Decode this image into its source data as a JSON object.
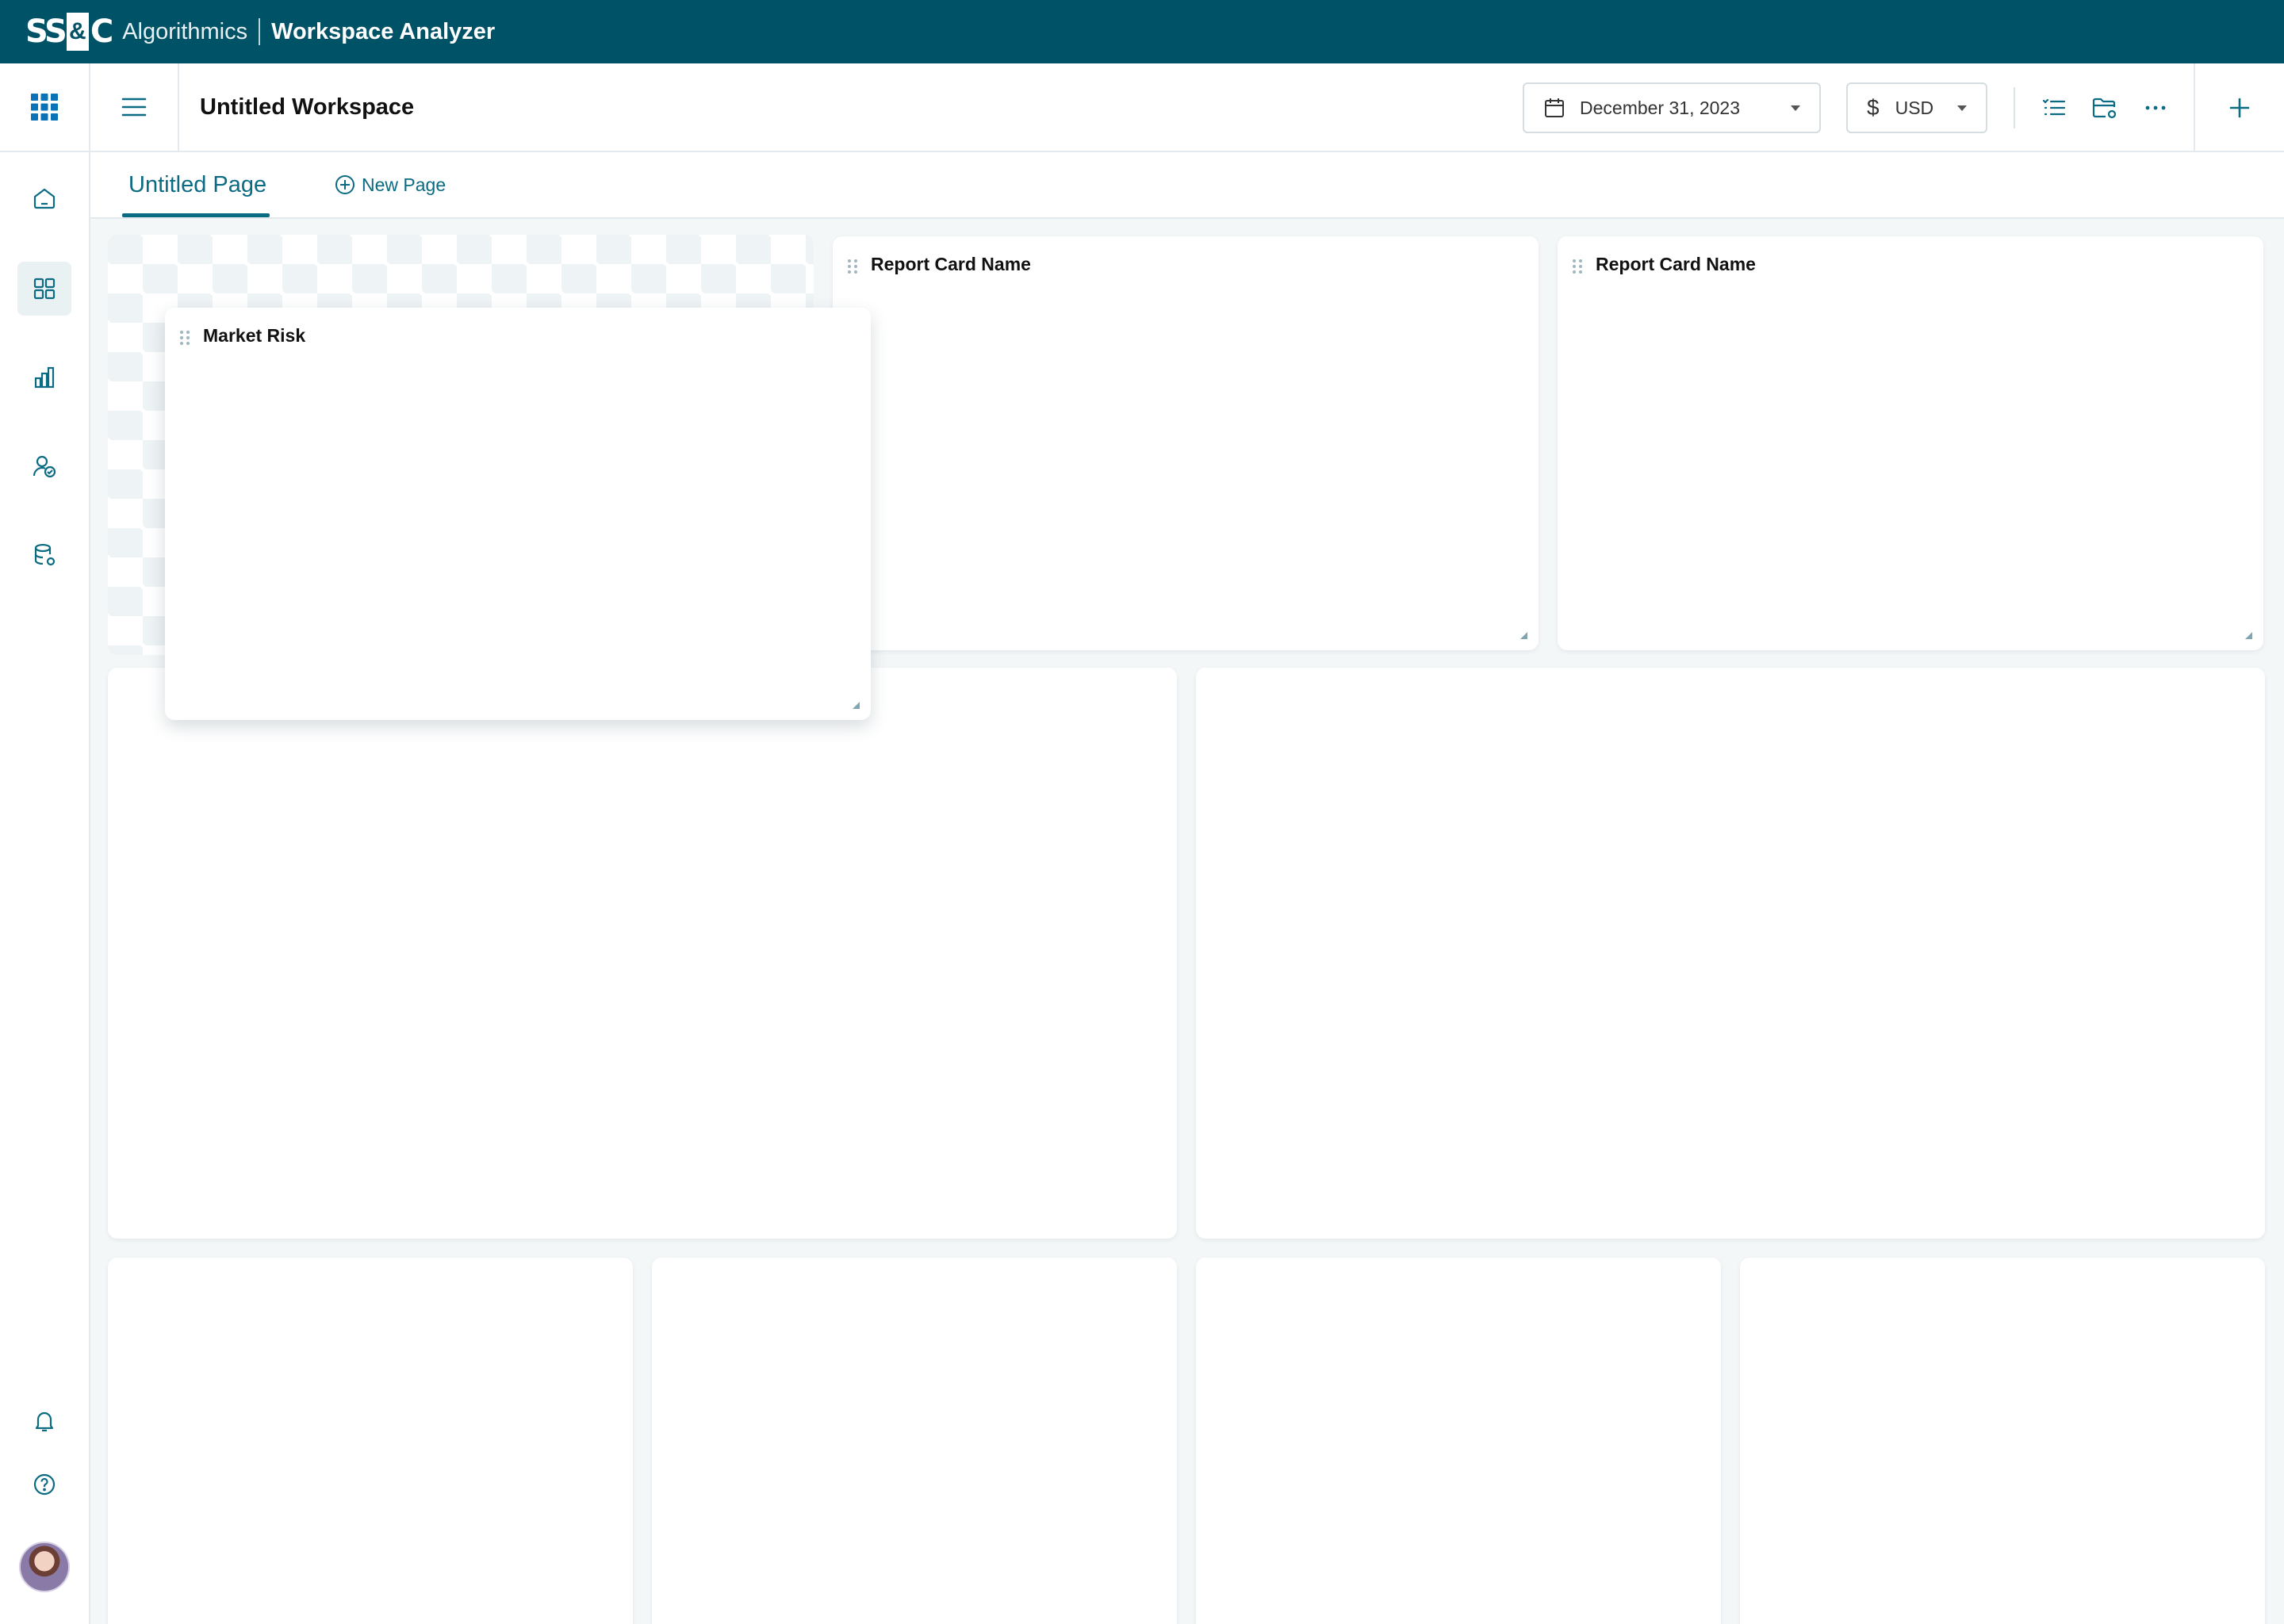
{
  "brand": {
    "logo_left": "SS",
    "logo_amp": "&",
    "logo_right": "C",
    "product": "Algorithmics",
    "app": "Workspace Analyzer"
  },
  "workspace": {
    "title": "Untitled Workspace"
  },
  "toolbar": {
    "date": "December 31, 2023",
    "currency_symbol": "$",
    "currency": "USD"
  },
  "tabs": [
    {
      "label": "Untitled Page",
      "active": true
    }
  ],
  "new_page_label": "New Page",
  "cards": [
    {
      "title": "Market Risk"
    },
    {
      "title": "Report Card Name"
    },
    {
      "title": "Report Card Name"
    }
  ],
  "rail": {
    "items": [
      "home-icon",
      "dashboard-icon",
      "chart-icon",
      "user-check-icon",
      "database-icon"
    ],
    "bottom": [
      "bell-icon",
      "help-icon"
    ]
  },
  "colors": {
    "brand_bar": "#005266",
    "accent": "#0b6b82",
    "apps_icon": "#0a73b7"
  }
}
